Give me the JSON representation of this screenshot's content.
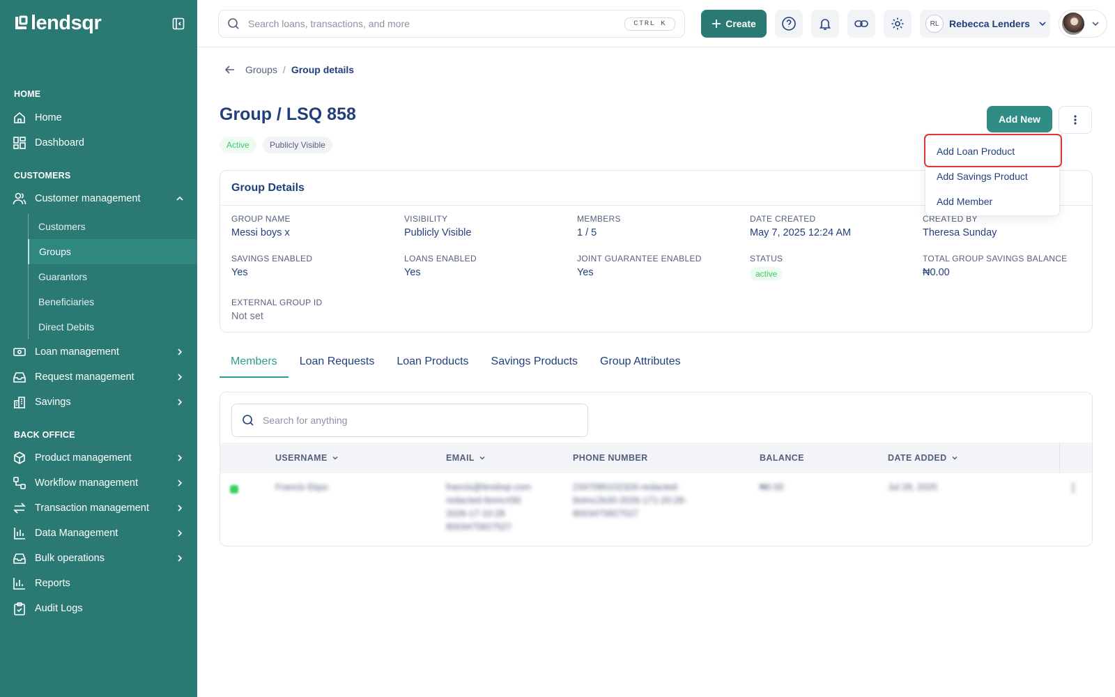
{
  "brand": {
    "name": "lendsqr"
  },
  "sidebar": {
    "sections": {
      "home": "HOME",
      "customers": "CUSTOMERS",
      "back_office": "BACK OFFICE"
    },
    "home": {
      "label": "Home"
    },
    "dashboard": {
      "label": "Dashboard"
    },
    "customer_management": {
      "label": "Customer management"
    },
    "sub": {
      "customers": "Customers",
      "groups": "Groups",
      "guarantors": "Guarantors",
      "beneficiaries": "Beneficiaries",
      "direct_debits": "Direct Debits"
    },
    "loan_management": {
      "label": "Loan management"
    },
    "request_management": {
      "label": "Request management"
    },
    "savings": {
      "label": "Savings"
    },
    "product_management": {
      "label": "Product management"
    },
    "workflow_management": {
      "label": "Workflow management"
    },
    "transaction_management": {
      "label": "Transaction management"
    },
    "data_management": {
      "label": "Data Management"
    },
    "bulk_operations": {
      "label": "Bulk operations"
    },
    "reports": {
      "label": "Reports"
    },
    "audit_logs": {
      "label": "Audit Logs"
    }
  },
  "topbar": {
    "search_placeholder": "Search loans, transactions, and more",
    "shortcut": "CTRL K",
    "create_label": "Create",
    "user_initials": "RL",
    "user_name": "Rebecca Lenders"
  },
  "breadcrumb": {
    "parent": "Groups",
    "separator": "/",
    "current": "Group details"
  },
  "page": {
    "title": "Group / LSQ 858",
    "badges": {
      "status": "Active",
      "visibility": "Publicly Visible"
    },
    "add_new_label": "Add New"
  },
  "dropdown": {
    "items": [
      "Add Loan Product",
      "Add Savings Product",
      "Add Member"
    ]
  },
  "details": {
    "heading": "Group Details",
    "fields": [
      {
        "label": "GROUP NAME",
        "value": "Messi boys x"
      },
      {
        "label": "VISIBILITY",
        "value": "Publicly Visible"
      },
      {
        "label": "MEMBERS",
        "value": "1 / 5"
      },
      {
        "label": "DATE CREATED",
        "value": "May 7, 2025 12:24 AM"
      },
      {
        "label": "CREATED BY",
        "value": "Theresa Sunday"
      },
      {
        "label": "SAVINGS ENABLED",
        "value": "Yes"
      },
      {
        "label": "LOANS ENABLED",
        "value": "Yes"
      },
      {
        "label": "JOINT GUARANTEE ENABLED",
        "value": "Yes"
      },
      {
        "label": "STATUS",
        "value": "active"
      },
      {
        "label": "TOTAL GROUP SAVINGS BALANCE",
        "value": "₦0.00"
      },
      {
        "label": "EXTERNAL GROUP ID",
        "value": "Not set"
      }
    ]
  },
  "tabs": [
    "Members",
    "Loan Requests",
    "Loan Products",
    "Savings Products",
    "Group Attributes"
  ],
  "table": {
    "search_placeholder": "Search for anything",
    "columns": [
      "USERNAME",
      "EMAIL",
      "PHONE NUMBER",
      "BALANCE",
      "DATE ADDED"
    ],
    "rows": [
      {
        "username": "Francis Ekpo",
        "email": [
          "francis@lendsqr.com",
          "redacted-9xmcrl30",
          "2026-17-10:28",
          "8003475827527"
        ],
        "phone": [
          "2347080152326-redacted-",
          "9xtmc2k30-2026-171-20:28-",
          "8003475827527"
        ],
        "balance": "₦0.00",
        "date_added": "Jul 28, 2025"
      }
    ]
  },
  "colors": {
    "sidebar": "#2a7a73",
    "accent": "#2a9d8f",
    "primary_text": "#213f7d",
    "highlight": "#e03535",
    "success": "#39cd62"
  }
}
